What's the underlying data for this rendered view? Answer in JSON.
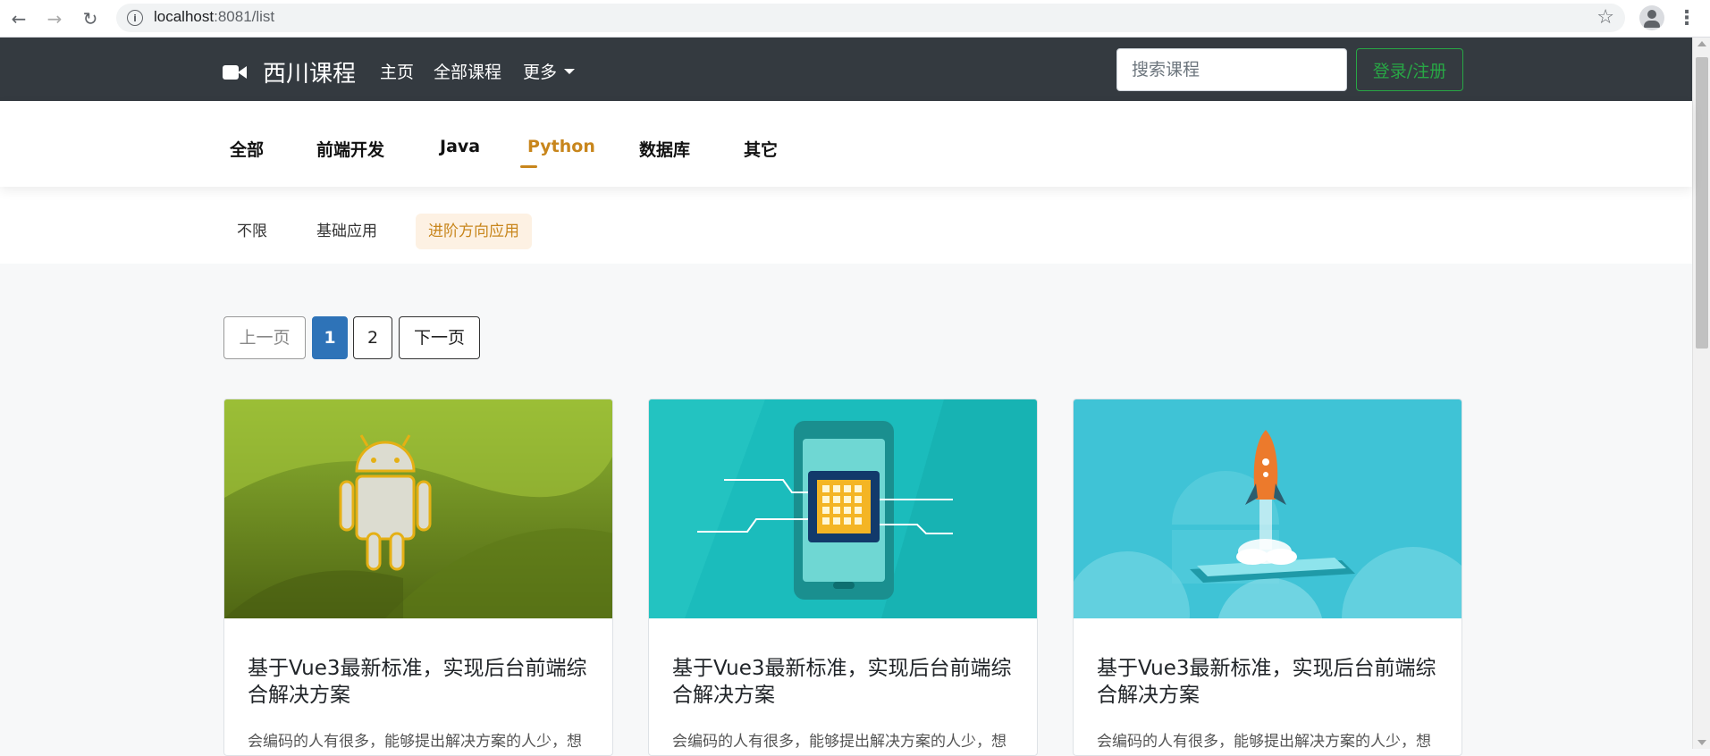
{
  "browser": {
    "url_host": "localhost",
    "url_rest": ":8081/list"
  },
  "navbar": {
    "brand": "西川课程",
    "links": [
      "主页",
      "全部课程",
      "更多"
    ],
    "search_placeholder": "搜索课程",
    "login_label": "登录/注册"
  },
  "categories": {
    "tabs": [
      "全部",
      "前端开发",
      "Java",
      "Python",
      "数据库",
      "其它"
    ],
    "active": "Python"
  },
  "subcategories": {
    "tabs": [
      "不限",
      "基础应用",
      "进阶方向应用"
    ],
    "active": "进阶方向应用"
  },
  "pagination": {
    "prev": "上一页",
    "pages": [
      "1",
      "2"
    ],
    "current": "1",
    "next": "下一页"
  },
  "courses": [
    {
      "title": "基于Vue3最新标准，实现后台前端综合解决方案",
      "desc": "会编码的人有很多，能够提出解决方案的人少，想",
      "image": "android-robot-green"
    },
    {
      "title": "基于Vue3最新标准，实现后台前端综合解决方案",
      "desc": "会编码的人有很多，能够提出解决方案的人少，想",
      "image": "phone-chip-teal"
    },
    {
      "title": "基于Vue3最新标准，实现后台前端综合解决方案",
      "desc": "会编码的人有很多，能够提出解决方案的人少，想",
      "image": "rocket-tablet-cyan"
    }
  ],
  "colors": {
    "navbar_bg": "#343a40",
    "accent": "#c8861c",
    "login_green": "#28a745",
    "page_active": "#2e73b8"
  }
}
